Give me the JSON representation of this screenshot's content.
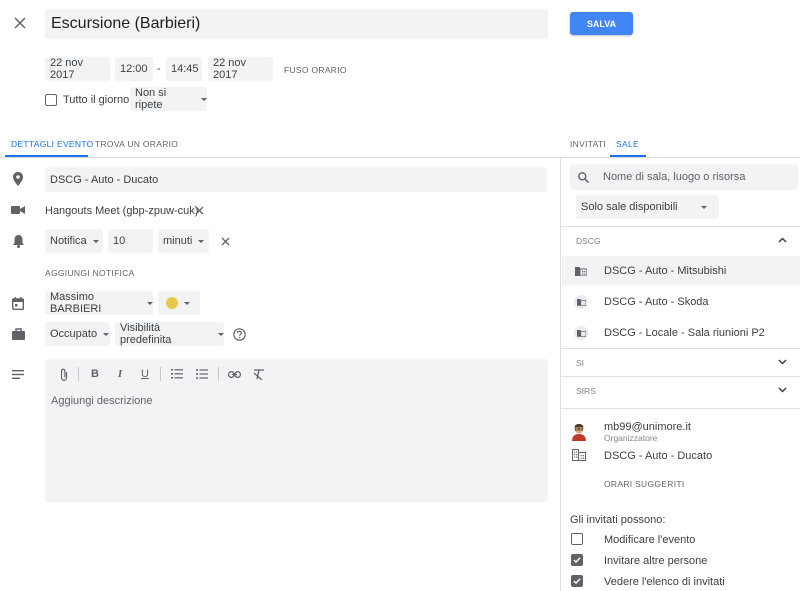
{
  "header": {
    "title": "Escursione (Barbieri)",
    "save_label": "SALVA"
  },
  "datetime": {
    "start_date": "22 nov 2017",
    "start_time": "12:00",
    "separator": "-",
    "end_time": "14:45",
    "end_date": "22 nov 2017",
    "timezone_label": "FUSO ORARIO",
    "all_day_label": "Tutto il giorno",
    "repeat_label": "Non si ripete"
  },
  "tabs_left": {
    "details": "DETTAGLI EVENTO",
    "find_time": "TROVA UN ORARIO"
  },
  "tabs_right": {
    "guests": "INVITATI",
    "rooms": "SALE"
  },
  "details": {
    "location": "DSCG - Auto - Ducato",
    "conference": "Hangouts Meet (gbp-zpuw-cuk)",
    "notification_type": "Notifica",
    "notification_value": "10",
    "notification_unit": "minuti",
    "add_notification": "AGGIUNGI NOTIFICA",
    "calendar_owner": "Massimo BARBIERI",
    "calendar_color": "#e6c84a",
    "availability": "Occupato",
    "visibility": "Visibilità predefinita",
    "description_placeholder": "Aggiungi descrizione"
  },
  "rooms": {
    "search_placeholder": "Nome di sala, luogo o risorsa",
    "filter": "Solo sale disponibili",
    "groups": [
      {
        "name": "DSCG",
        "rooms": [
          "DSCG - Auto - Mitsubishi",
          "DSCG - Auto - Skoda",
          "DSCG - Locale - Sala riunioni P2"
        ]
      },
      {
        "name": "SI"
      },
      {
        "name": "SIRS"
      }
    ]
  },
  "guests": {
    "organizer_email": "mb99@unimore.it",
    "organizer_role": "Organizzatore",
    "room_guest": "DSCG - Auto - Ducato",
    "suggested_times": "ORARI SUGGERITI",
    "permissions_title": "Gli invitati possono:",
    "permissions": [
      {
        "label": "Modificare l'evento",
        "checked": false
      },
      {
        "label": "Invitare altre persone",
        "checked": true
      },
      {
        "label": "Vedere l'elenco di invitati",
        "checked": true
      }
    ]
  },
  "colors": {
    "accent": "#1a73e8",
    "save_button": "#4285f4",
    "field_bg": "#f1f3f4"
  }
}
